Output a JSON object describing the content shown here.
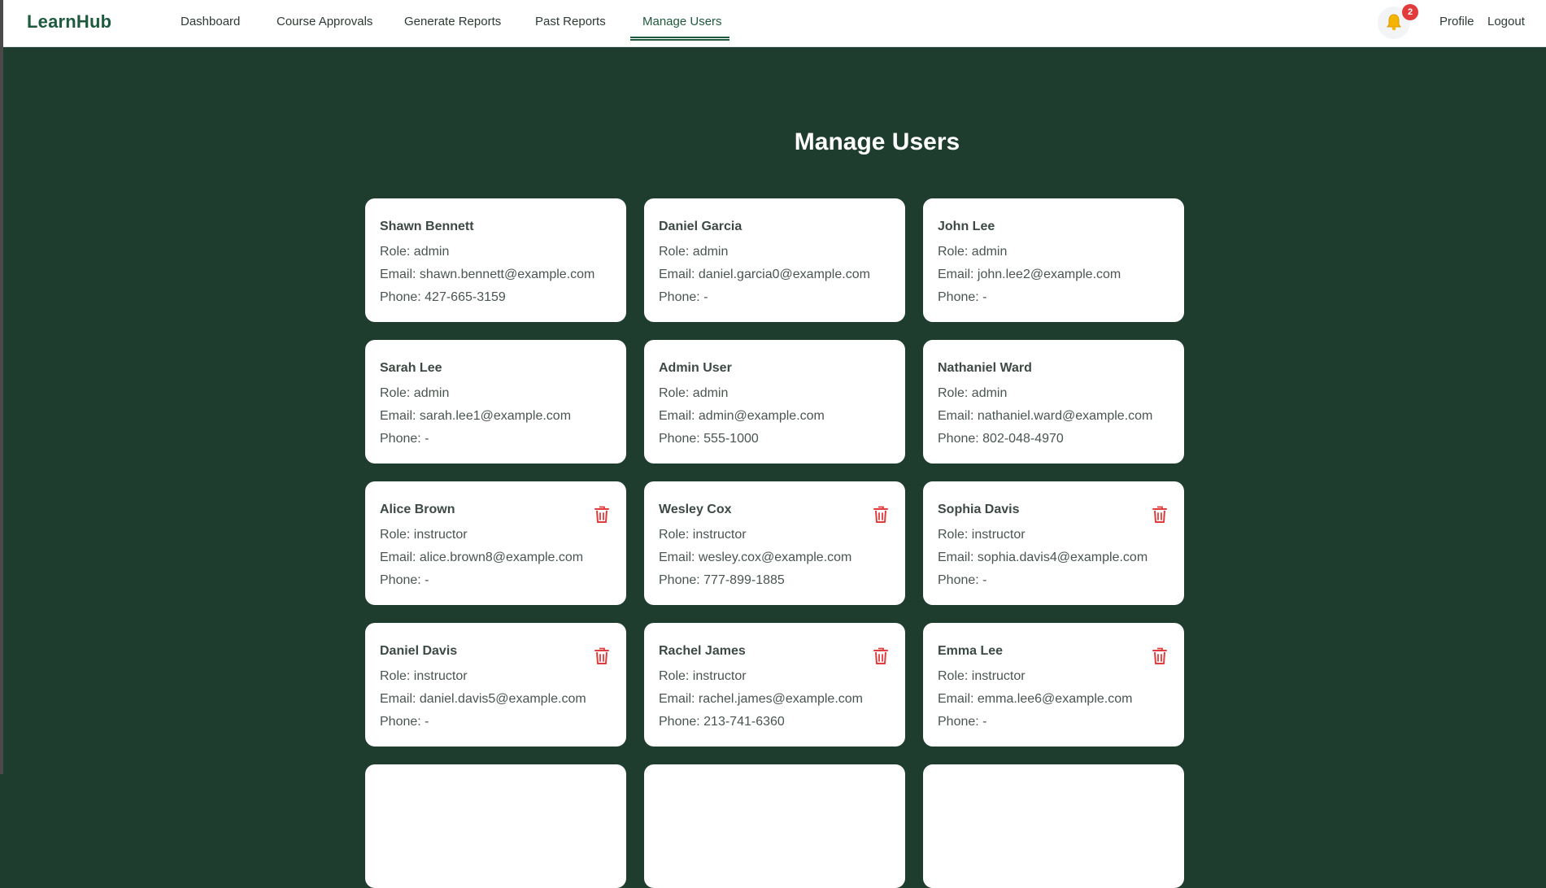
{
  "app": {
    "logo": "LearnHub"
  },
  "nav": {
    "items": [
      "Dashboard",
      "Course Approvals",
      "Generate Reports",
      "Past Reports",
      "Manage Users"
    ],
    "active": "Manage Users"
  },
  "notifications": {
    "count": "2",
    "icon": "bell-icon"
  },
  "header_links": {
    "profile": "Profile",
    "logout": "Logout"
  },
  "page": {
    "title": "Manage Users"
  },
  "labels": {
    "role": "Role: ",
    "email": "Email: ",
    "phone": "Phone: "
  },
  "colors": {
    "background": "#1e3d2f",
    "brand": "#1e5a3e",
    "delete": "#e03c3c"
  },
  "users": [
    {
      "name": "Shawn Bennett",
      "role": "admin",
      "email": "shawn.bennett@example.com",
      "phone": "427-665-3159",
      "deletable": false
    },
    {
      "name": "Daniel Garcia",
      "role": "admin",
      "email": "daniel.garcia0@example.com",
      "phone": "-",
      "deletable": false
    },
    {
      "name": "John Lee",
      "role": "admin",
      "email": "john.lee2@example.com",
      "phone": "-",
      "deletable": false
    },
    {
      "name": "Sarah Lee",
      "role": "admin",
      "email": "sarah.lee1@example.com",
      "phone": "-",
      "deletable": false
    },
    {
      "name": "Admin User",
      "role": "admin",
      "email": "admin@example.com",
      "phone": "555-1000",
      "deletable": false
    },
    {
      "name": "Nathaniel Ward",
      "role": "admin",
      "email": "nathaniel.ward@example.com",
      "phone": "802-048-4970",
      "deletable": false
    },
    {
      "name": "Alice Brown",
      "role": "instructor",
      "email": "alice.brown8@example.com",
      "phone": "-",
      "deletable": true
    },
    {
      "name": "Wesley Cox",
      "role": "instructor",
      "email": "wesley.cox@example.com",
      "phone": "777-899-1885",
      "deletable": true
    },
    {
      "name": "Sophia Davis",
      "role": "instructor",
      "email": "sophia.davis4@example.com",
      "phone": "-",
      "deletable": true
    },
    {
      "name": "Daniel Davis",
      "role": "instructor",
      "email": "daniel.davis5@example.com",
      "phone": "-",
      "deletable": true
    },
    {
      "name": "Rachel James",
      "role": "instructor",
      "email": "rachel.james@example.com",
      "phone": "213-741-6360",
      "deletable": true
    },
    {
      "name": "Emma Lee",
      "role": "instructor",
      "email": "emma.lee6@example.com",
      "phone": "-",
      "deletable": true
    },
    {
      "name": "",
      "role": "",
      "email": "",
      "phone": "",
      "deletable": false
    },
    {
      "name": "",
      "role": "",
      "email": "",
      "phone": "",
      "deletable": false
    },
    {
      "name": "",
      "role": "",
      "email": "",
      "phone": "",
      "deletable": false
    }
  ]
}
